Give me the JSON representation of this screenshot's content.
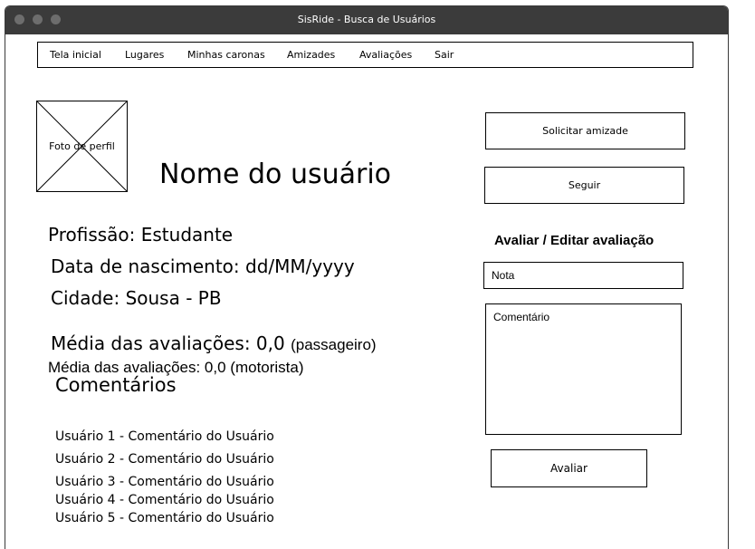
{
  "window": {
    "title": "SisRide - Busca de Usuários"
  },
  "nav": {
    "items": [
      "Tela inicial",
      "Lugares",
      "Minhas caronas",
      "Amizades",
      "Avaliações",
      "Sair"
    ]
  },
  "profile": {
    "photo_label": "Foto de perfil",
    "name": "Nome do usuário",
    "profession": "Profissão: Estudante",
    "birthdate": "Data de nascimento: dd/MM/yyyy",
    "city": "Cidade: Sousa - PB",
    "rating_passenger_label": "Média das avaliações: 0,0",
    "rating_passenger_role": "(passageiro)",
    "rating_driver": "Média das avaliações: 0,0 (motorista)"
  },
  "comments": {
    "heading": "Comentários",
    "items": [
      "Usuário 1 - Comentário do Usuário",
      "Usuário 2 - Comentário do Usuário",
      "Usuário 3 - Comentário do Usuário",
      "Usuário 4 - Comentário do Usuário",
      "Usuário 5 - Comentário do Usuário"
    ]
  },
  "actions": {
    "friend_request": "Solicitar amizade",
    "follow": "Seguir"
  },
  "rating_form": {
    "heading": "Avaliar / Editar avaliação",
    "score_placeholder": "Nota",
    "comment_placeholder": "Comentário",
    "submit": "Avaliar"
  }
}
